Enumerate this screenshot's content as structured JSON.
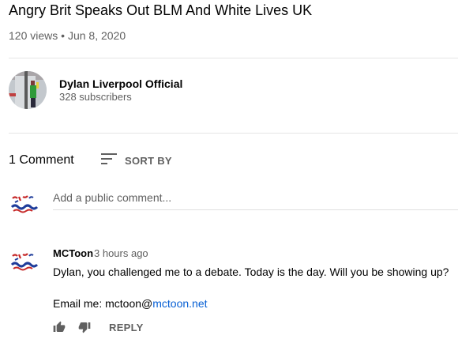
{
  "video": {
    "title": "Angry Brit Speaks Out BLM And White Lives UK",
    "views": "120 views",
    "separator": "•",
    "date": "Jun 8, 2020"
  },
  "channel": {
    "name": "Dylan Liverpool Official",
    "subscribers": "328 subscribers"
  },
  "comments": {
    "count_label": "1 Comment",
    "sort_label": "SORT BY",
    "add_placeholder": "Add a public comment...",
    "items": [
      {
        "author": "MCToon",
        "time": "3 hours ago",
        "text": "Dylan, you challenged me to a debate.  Today is the day.  Will you be showing up?",
        "email_prefix": "Email me: mctoon@",
        "email_link": "mctoon.net",
        "reply_label": "REPLY"
      }
    ]
  },
  "colors": {
    "link": "#065fd4",
    "secondary_text": "#606060",
    "divider": "#e5e5e5"
  },
  "icons": {
    "sort": "sort-icon",
    "like": "thumbs-up-icon",
    "dislike": "thumbs-down-icon"
  }
}
